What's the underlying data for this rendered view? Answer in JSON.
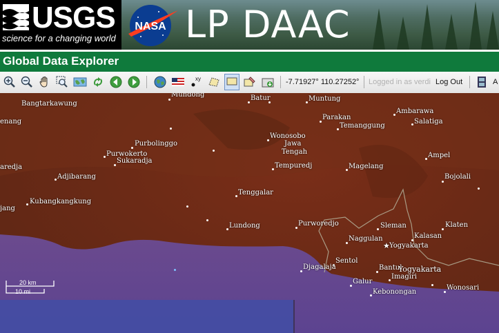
{
  "header": {
    "usgs_wordmark": "USGS",
    "usgs_tagline": "science for a changing world",
    "nasa_wordmark": "NASA",
    "title": "LP DAAC"
  },
  "app": {
    "title": "Global Data Explorer"
  },
  "toolbar": {
    "coordinates": "-7.71927° 110.27252°",
    "logged_in": "Logged in as verdi",
    "logout_label": "Log Out",
    "extra_label": "A",
    "tools": [
      "zoom-in",
      "zoom-out",
      "pan",
      "zoom-box",
      "full-extent",
      "refresh",
      "back",
      "forward",
      "globe",
      "us-flag",
      "xy-point",
      "polygon-select",
      "rectangle-select",
      "edit-select",
      "download"
    ],
    "selected_tool": "rectangle-select"
  },
  "map": {
    "scale_km": "20 km",
    "scale_mi": "10 mi",
    "places": [
      "Bangtarkawung",
      "Mundong",
      "Batur",
      "Muntung",
      "Parakan",
      "Ambarawa",
      "Temanggung",
      "Salatiga",
      "enang",
      "Purbolinggo",
      "Wonosobo",
      "Jawa",
      "Tengah",
      "Purwokerto",
      "Sukaradja",
      "Ampel",
      "aredja",
      "Tempuredj",
      "Magelang",
      "Bojolali",
      "Adjibarang",
      "Tenggalar",
      "Kubangkangkung",
      "jang",
      "Lundong",
      "Purworedjo",
      "Sleman",
      "Klaten",
      "Kalasan",
      "Naggulan",
      "Yogyakarta",
      "Sentol",
      "Djagalaja",
      "Bantul",
      "Yogyakarta",
      "Imagiri",
      "Galur",
      "Wonosari",
      "Kebonongan"
    ]
  }
}
